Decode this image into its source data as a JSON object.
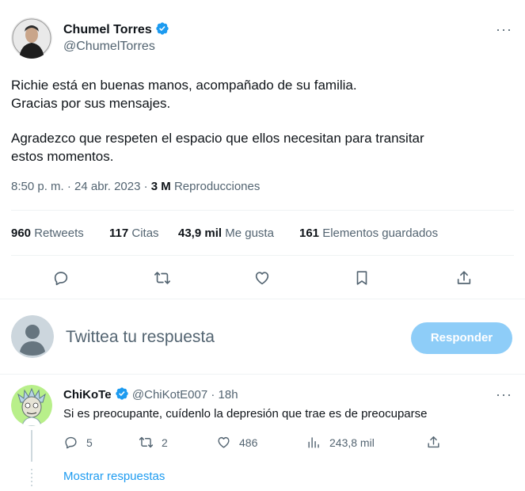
{
  "tweet": {
    "author_name": "Chumel Torres",
    "author_handle": "@ChumelTorres",
    "body_line1": "Richie está en buenas manos, acompañado de su familia.",
    "body_line2": "Gracias por sus mensajes.",
    "body_line3": "Agradezco que respeten el espacio que ellos necesitan para transitar",
    "body_line4": "estos momentos.",
    "time": "8:50 p. m. · 24 abr. 2023 ·",
    "views_count": "3 M",
    "views_label": "Reproducciones",
    "more_label": "···"
  },
  "stats": [
    {
      "count": "960",
      "label": "Retweets"
    },
    {
      "count": "117",
      "label": "Citas"
    },
    {
      "count": "43,9 mil",
      "label": "Me gusta"
    },
    {
      "count": "161",
      "label": "Elementos guardados"
    }
  ],
  "composer": {
    "placeholder": "Twittea tu respuesta",
    "button_label": "Responder"
  },
  "reply": {
    "author_name": "ChiKoTe",
    "author_handle": "@ChiKotE007",
    "time": "· 18h",
    "text": "Si es preocupante, cuídenlo la depresión que trae es de preocuparse",
    "replies": "5",
    "retweets": "2",
    "likes": "486",
    "views": "243,8 mil",
    "more_label": "···",
    "show_replies": "Mostrar respuestas"
  },
  "colors": {
    "accent": "#1d9bf0",
    "accent_disabled": "#8ecdf8",
    "text": "#0f1419",
    "muted": "#536471",
    "border": "#eff3f4"
  },
  "icons": [
    "verified-badge-icon",
    "more-icon",
    "reply-icon",
    "retweet-icon",
    "like-icon",
    "bookmark-icon",
    "share-icon",
    "views-icon"
  ]
}
